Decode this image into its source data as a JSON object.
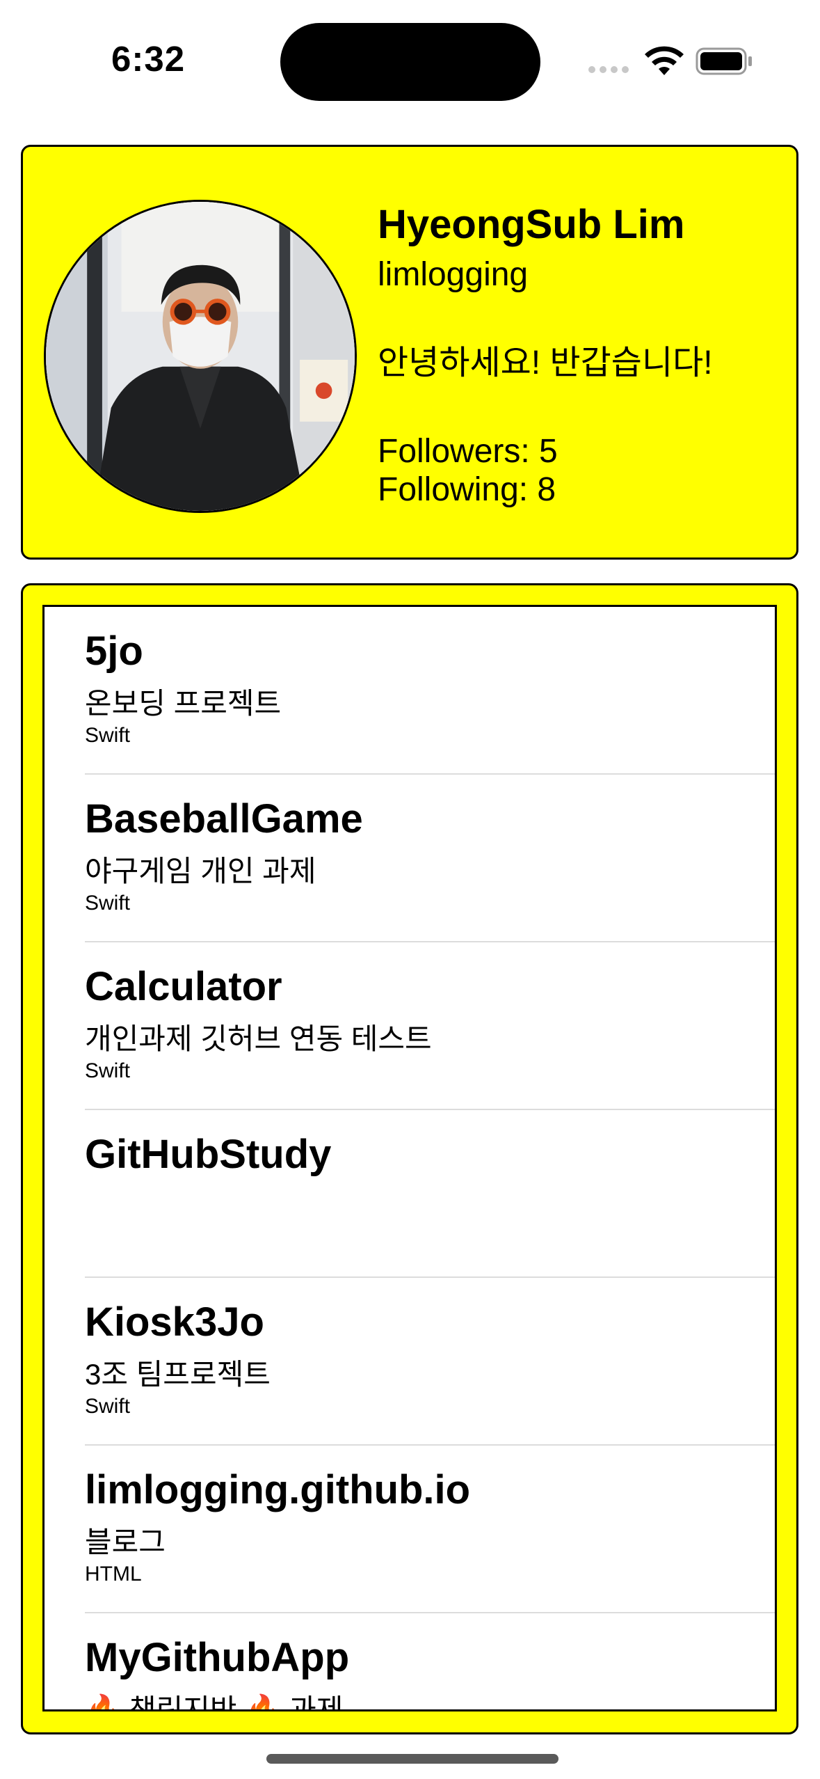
{
  "status_bar": {
    "time": "6:32"
  },
  "profile": {
    "name": "HyeongSub Lim",
    "login": "limlogging",
    "bio": "안녕하세요! 반갑습니다!",
    "followers": "Followers: 5",
    "following": "Following: 8"
  },
  "repos": [
    {
      "name": "5jo",
      "description": "온보딩 프로젝트",
      "language": "Swift"
    },
    {
      "name": "BaseballGame",
      "description": "야구게임 개인 과제",
      "language": "Swift"
    },
    {
      "name": "Calculator",
      "description": "개인과제 깃허브 연동 테스트",
      "language": "Swift"
    },
    {
      "name": "GitHubStudy",
      "description": "",
      "language": ""
    },
    {
      "name": "Kiosk3Jo",
      "description": "3조 팀프로젝트",
      "language": "Swift"
    },
    {
      "name": "limlogging.github.io",
      "description": "블로그",
      "language": "HTML"
    },
    {
      "name": "MyGithubApp",
      "description": "🔥 책린지반 🔥 과제",
      "language": ""
    }
  ],
  "colors": {
    "card_background": "#ffff00",
    "border": "#000000"
  }
}
